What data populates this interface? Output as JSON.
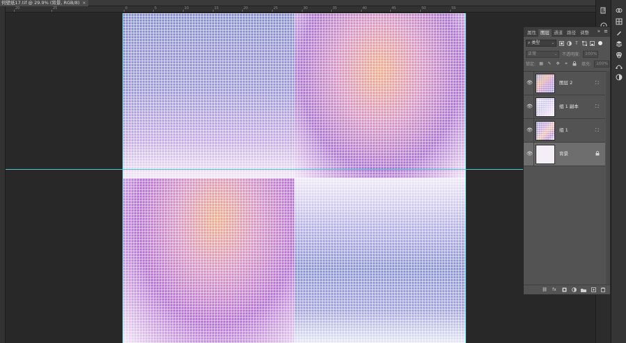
{
  "document": {
    "tab_title": "何壁纸17.tif @ 29.9% (背景, RGB/8)",
    "close_glyph": "×"
  },
  "ruler": {
    "ticks": [
      "20",
      "25",
      "0",
      "5",
      "10",
      "15",
      "20",
      "25",
      "30",
      "35",
      "40",
      "45",
      "50",
      "55"
    ]
  },
  "layers_panel": {
    "tabs": [
      "属性",
      "图层",
      "通道",
      "路径",
      "调整"
    ],
    "active_tab": "图层",
    "collapse_glyph": "»",
    "menu_glyph": "≡",
    "filter": {
      "label": "类型",
      "caret": "⌄"
    },
    "blend_mode": {
      "value": "正常",
      "caret": "⌄"
    },
    "opacity": {
      "label": "不透明度:",
      "value": "100%"
    },
    "lock": {
      "label": "锁定:"
    },
    "fill": {
      "label": "填充:",
      "value": "100%"
    },
    "layers": [
      {
        "name": "图层 2",
        "visible": true,
        "locked": false
      },
      {
        "name": "组 1 副本",
        "visible": true,
        "locked": false
      },
      {
        "name": "组 1",
        "visible": true,
        "locked": false
      },
      {
        "name": "背景",
        "visible": true,
        "locked": true,
        "selected": true
      }
    ]
  },
  "colors": {
    "guide": "#4fc8d4",
    "panel_bg": "#535353",
    "selected_layer": "#6e6e6e",
    "workspace": "#282828"
  }
}
